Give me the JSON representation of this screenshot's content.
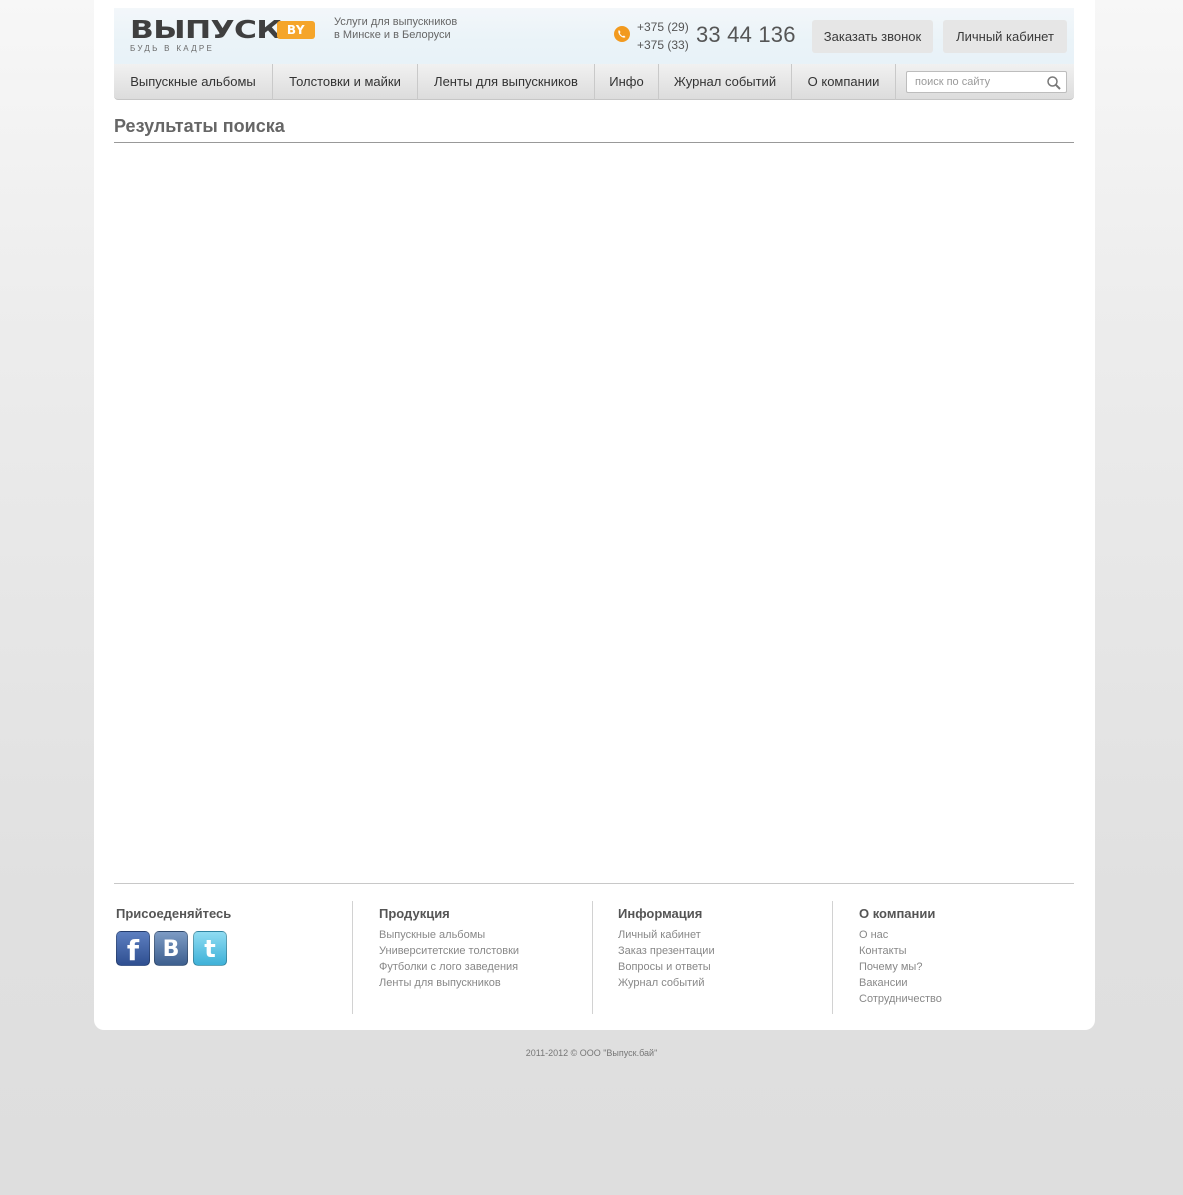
{
  "header": {
    "logo_text": "ВЫПУСК",
    "logo_badge": "BY",
    "logo_slogan": "БУДЬ В КАДРЕ",
    "tagline_line1": "Услуги для выпускников",
    "tagline_line2": "в Минске и в Белоруси",
    "phone_code1": "+375 (29)",
    "phone_code2": "+375 (33)",
    "phone_number": "33 44 136",
    "callback_button": "Заказать звонок",
    "cabinet_button": "Личный кабинет"
  },
  "nav": {
    "items": [
      {
        "label": "Выпускные альбомы"
      },
      {
        "label": "Толстовки и майки"
      },
      {
        "label": "Ленты для выпускников"
      },
      {
        "label": "Инфо"
      },
      {
        "label": "Журнал событий"
      },
      {
        "label": "О компании"
      }
    ],
    "search_placeholder": "поиск по сайту",
    "search_value": ""
  },
  "main": {
    "title": "Результаты поиска"
  },
  "footer": {
    "social": {
      "title": "Присоеденяйтесь",
      "icons": [
        "facebook-icon",
        "vkontakte-icon",
        "twitter-icon"
      ]
    },
    "products": {
      "title": "Продукция",
      "links": [
        "Выпускные альбомы",
        "Университетские толстовки",
        "Футболки с лого заведения",
        "Ленты для выпускников"
      ]
    },
    "info": {
      "title": "Информация",
      "links": [
        "Личный кабинет",
        "Заказ презентации",
        "Вопросы и ответы",
        "Журнал событий"
      ]
    },
    "company": {
      "title": "О компании",
      "links": [
        "О нас",
        "Контакты",
        "Почему мы?",
        "Вакансии",
        "Сотрудничество"
      ]
    },
    "copyright": "2011-2012  ©  ООО \"Выпуск.бай\""
  },
  "colors": {
    "accent": "#f5a52a",
    "phone_icon": "#f29a1f"
  }
}
